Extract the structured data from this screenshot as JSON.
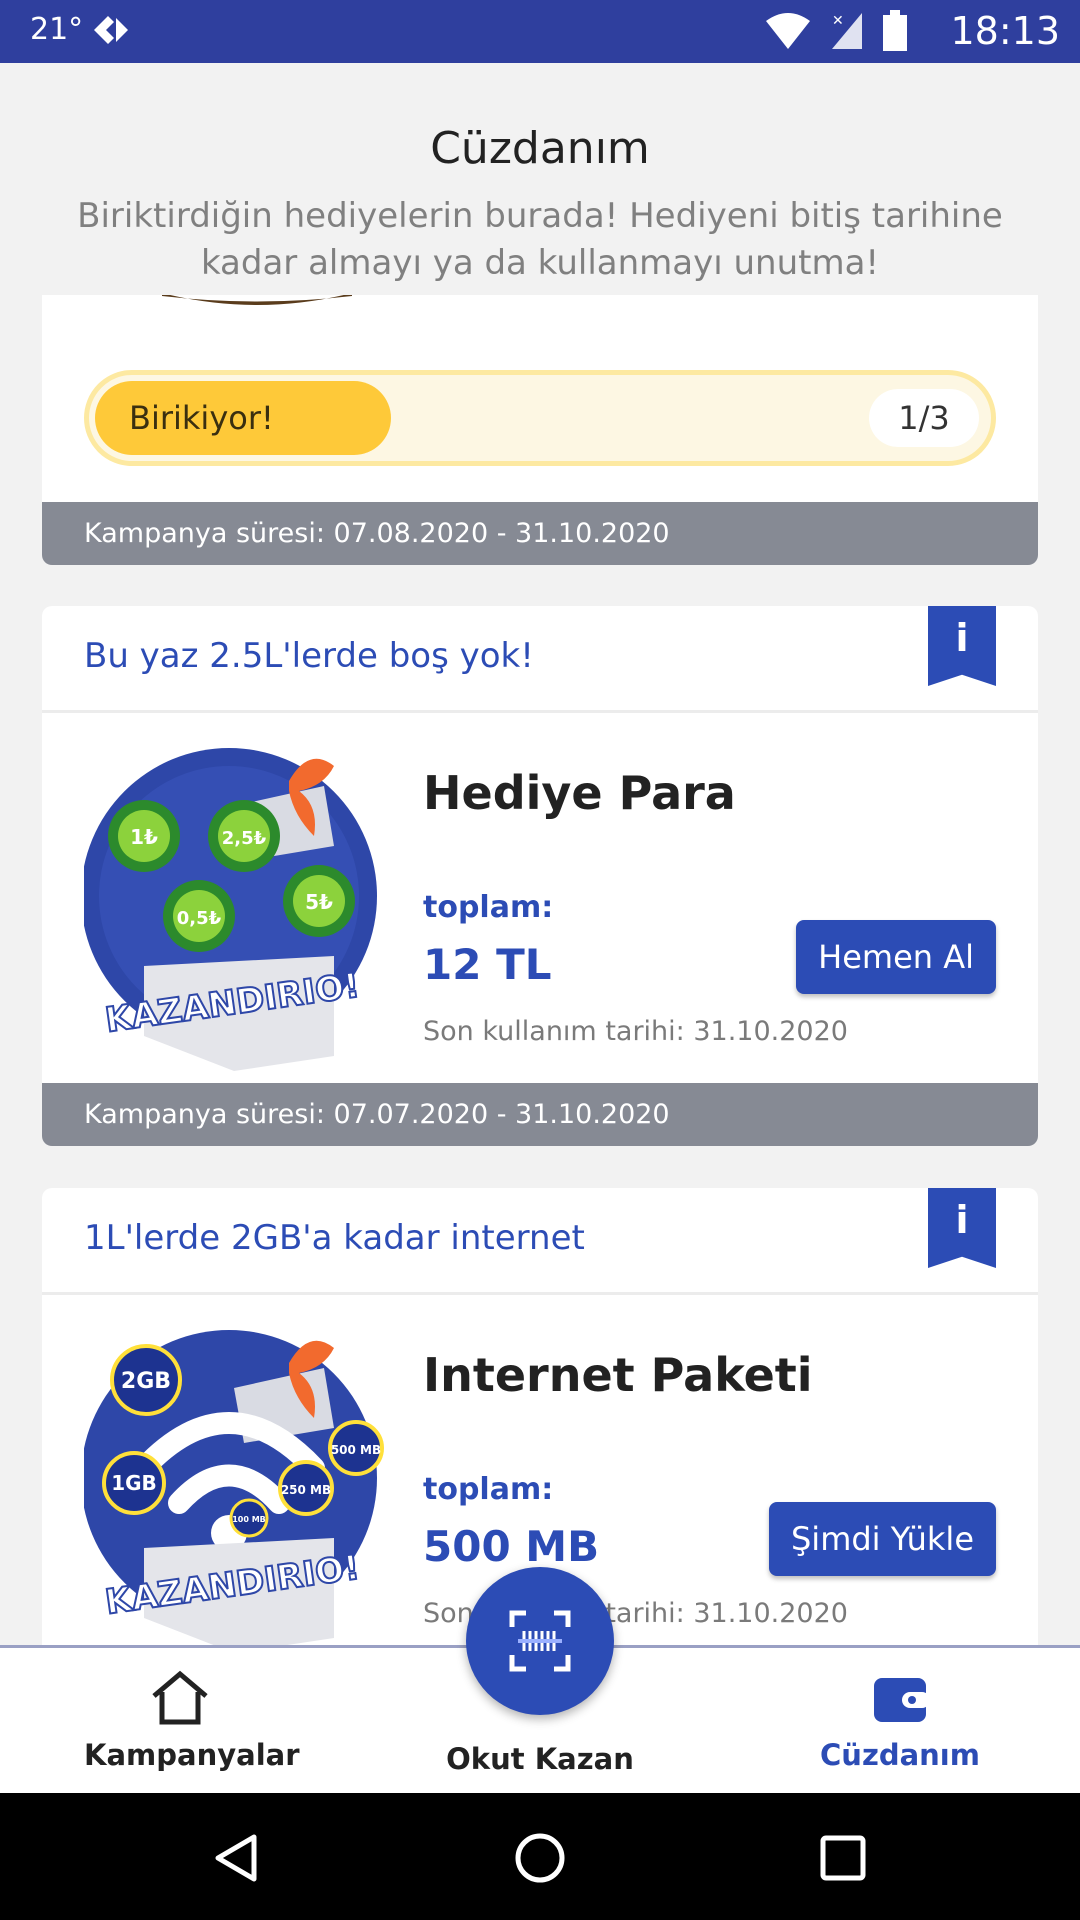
{
  "status_bar": {
    "temperature": "21°",
    "time": "18:13"
  },
  "header": {
    "title": "Cüzdanım",
    "subtitle": "Biriktirdiğin hediyelerin burada! Hediyeni bitiş tarihine kadar almayı ya da kullanmayı unutma!"
  },
  "progress_card": {
    "status_label": "Birikiyor!",
    "count_label": "1/3",
    "progress_fraction": 0.333,
    "campaign_period": "Kampanya süresi: 07.08.2020 - 31.10.2020"
  },
  "cards": [
    {
      "headline": "Bu yaz 2.5L'lerde boş yok!",
      "info_icon_glyph": "i",
      "product_name": "Hediye Para",
      "total_label": "toplam:",
      "total_value": "12 TL",
      "button_label": "Hemen Al",
      "expiry": "Son kullanım tarihi: 31.10.2020",
      "campaign_period": "Kampanya süresi: 07.07.2020 - 31.10.2020",
      "image": {
        "chip_labels": [
          "1₺",
          "2,5₺",
          "0,5₺",
          "5₺"
        ],
        "brand_text": "KAZANDIRIO!"
      }
    },
    {
      "headline": "1L'lerde 2GB'a kadar internet",
      "info_icon_glyph": "i",
      "product_name": "Internet Paketi",
      "total_label": "toplam:",
      "total_value": "500 MB",
      "button_label": "Şimdi Yükle",
      "expiry": "Son kullanım tarihi: 31.10.2020",
      "image": {
        "badge_labels": [
          "2GB",
          "1GB",
          "250 MB",
          "500 MB",
          "100 MB"
        ],
        "brand_text": "KAZANDIRIO!"
      }
    }
  ],
  "bottom_nav": {
    "items": [
      {
        "label": "Kampanyalar",
        "icon": "home-icon",
        "active": false
      },
      {
        "label": "Okut Kazan",
        "icon": "scan-icon",
        "active": false
      },
      {
        "label": "Cüzdanım",
        "icon": "wallet-icon",
        "active": true
      }
    ]
  },
  "colors": {
    "brand_blue": "#2c4cb5",
    "status_bar": "#2f3f9e",
    "progress_yellow": "#fec939",
    "footer_gray": "#868a94"
  }
}
